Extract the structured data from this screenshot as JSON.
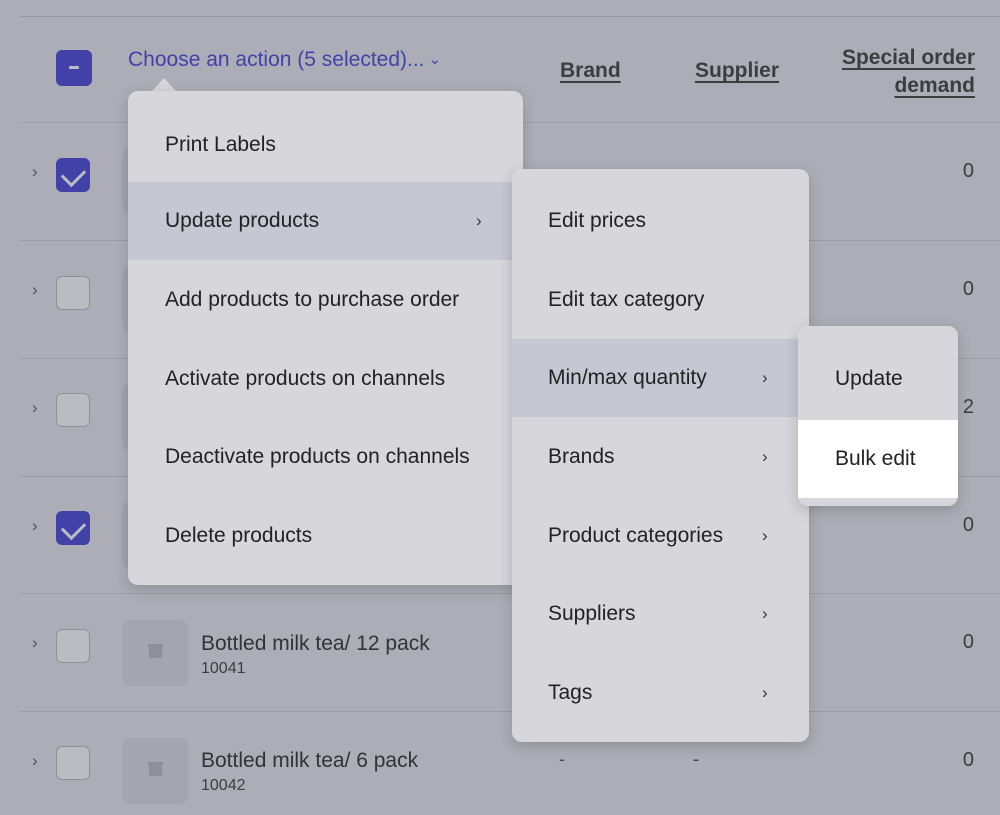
{
  "header": {
    "action_label": "Choose an action (5 selected)...",
    "action_chevron": "⌄",
    "columns": {
      "brand": "Brand",
      "supplier": "Supplier",
      "special_line1": "Special order",
      "special_line2": "demand"
    }
  },
  "rows": [
    {
      "checked": true,
      "name": "",
      "sku": "",
      "brand": "",
      "supplier": "",
      "demand": "0"
    },
    {
      "checked": false,
      "name": "",
      "sku": "",
      "brand": "",
      "supplier": "",
      "demand": "0"
    },
    {
      "checked": false,
      "name": "",
      "sku": "",
      "brand": "",
      "supplier": "",
      "demand": "2"
    },
    {
      "checked": true,
      "name": "",
      "sku": "",
      "brand": "",
      "supplier": "",
      "demand": "0"
    },
    {
      "checked": false,
      "name": "Bottled milk tea/ 12 pack",
      "sku": "10041",
      "brand": "",
      "supplier": "",
      "demand": "0"
    },
    {
      "checked": false,
      "name": "Bottled milk tea/ 6 pack",
      "sku": "10042",
      "brand": "-",
      "supplier": "-",
      "demand": "0"
    }
  ],
  "action_menu": {
    "items": [
      {
        "label": "Print Labels"
      },
      {
        "label": "Update products",
        "submenu": true,
        "active": true
      },
      {
        "label": "Add products to purchase order"
      },
      {
        "label": "Activate products on channels"
      },
      {
        "label": "Deactivate products on channels"
      },
      {
        "label": "Delete products"
      }
    ]
  },
  "update_submenu": {
    "items": [
      {
        "label": "Edit prices"
      },
      {
        "label": "Edit tax category"
      },
      {
        "label": "Min/max quantity",
        "submenu": true,
        "active": true
      },
      {
        "label": "Brands",
        "submenu": true
      },
      {
        "label": "Product categories",
        "submenu": true
      },
      {
        "label": "Suppliers",
        "submenu": true
      },
      {
        "label": "Tags",
        "submenu": true
      }
    ]
  },
  "minmax_submenu": {
    "items": [
      {
        "label": "Update"
      },
      {
        "label": "Bulk edit",
        "highlighted": true
      }
    ]
  },
  "icons": {
    "submenu_chevron": "›",
    "expand_chevron": "›",
    "select_all": "minus-icon",
    "row_checked": "checkmark-icon",
    "thumbnail": "box-icon"
  },
  "colors": {
    "accent": "#3b3bd6",
    "menu_bg": "#d6d6db",
    "menu_active": "#c6c7d3",
    "highlight": "#ffffff"
  }
}
